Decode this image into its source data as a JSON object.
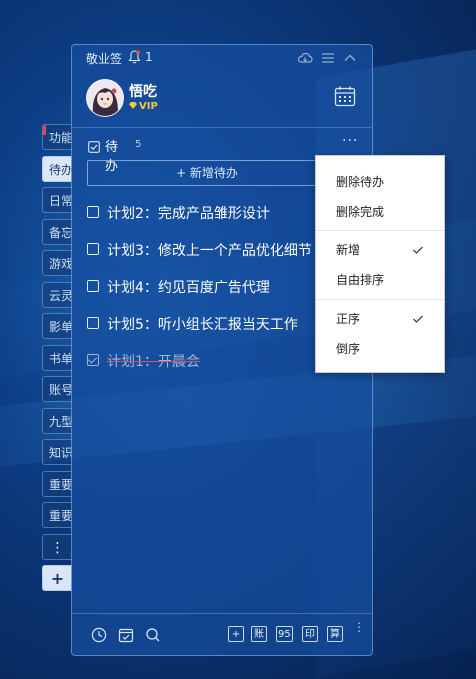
{
  "side_tabs": {
    "items": [
      {
        "label": "功能",
        "active": false,
        "flag": true
      },
      {
        "label": "待办",
        "active": true,
        "flag": false
      },
      {
        "label": "日常",
        "active": false,
        "flag": false
      },
      {
        "label": "备忘",
        "active": false,
        "flag": false
      },
      {
        "label": "游戏",
        "active": false,
        "flag": false
      },
      {
        "label": "云灵",
        "active": false,
        "flag": false
      },
      {
        "label": "影单",
        "active": false,
        "flag": false
      },
      {
        "label": "书单",
        "active": false,
        "flag": false
      },
      {
        "label": "账号",
        "active": false,
        "flag": false
      },
      {
        "label": "九型",
        "active": false,
        "flag": false
      },
      {
        "label": "知识",
        "active": false,
        "flag": false
      },
      {
        "label": "重要",
        "active": false,
        "flag": false
      },
      {
        "label": "重要",
        "active": false,
        "flag": false
      }
    ],
    "more_label": "⋮",
    "add_label": "+"
  },
  "titlebar": {
    "app_title": "敬业签",
    "notification_count": "1",
    "icons": [
      "bell-icon",
      "cloud-icon",
      "menu-icon",
      "chevron-up-icon"
    ]
  },
  "profile": {
    "username": "悟吃",
    "vip_label": "VIP"
  },
  "section": {
    "title": "待办",
    "count": "5",
    "more_label": "···",
    "add_label": "+ 新增待办"
  },
  "todos": [
    {
      "text": "计划2：完成产品雏形设计",
      "done": false
    },
    {
      "text": "计划3：修改上一个产品优化细节",
      "done": false
    },
    {
      "text": "计划4：约见百度广告代理",
      "done": false
    },
    {
      "text": "计划5：听小组长汇报当天工作",
      "done": false
    },
    {
      "text": "计划1：开晨会",
      "done": true
    }
  ],
  "footer": {
    "icons": [
      "clock-icon",
      "check-calendar-icon",
      "search-icon"
    ],
    "buttons": [
      {
        "label": "+",
        "name": "add-button"
      },
      {
        "label": "账",
        "name": "account-button"
      },
      {
        "label": "95",
        "name": "num95-button"
      },
      {
        "label": "印",
        "name": "print-button"
      },
      {
        "label": "算",
        "name": "calc-button"
      }
    ],
    "more_label": "⋮"
  },
  "menu": {
    "groups": [
      [
        {
          "label": "删除待办",
          "checked": false
        },
        {
          "label": "删除完成",
          "checked": false
        }
      ],
      [
        {
          "label": "新增",
          "checked": true
        },
        {
          "label": "自由排序",
          "checked": false
        }
      ],
      [
        {
          "label": "正序",
          "checked": true
        },
        {
          "label": "倒序",
          "checked": false
        }
      ]
    ]
  },
  "colors": {
    "accent": "#f5c542",
    "panel": "#1c4e9e",
    "flag": "#e04a3a"
  }
}
